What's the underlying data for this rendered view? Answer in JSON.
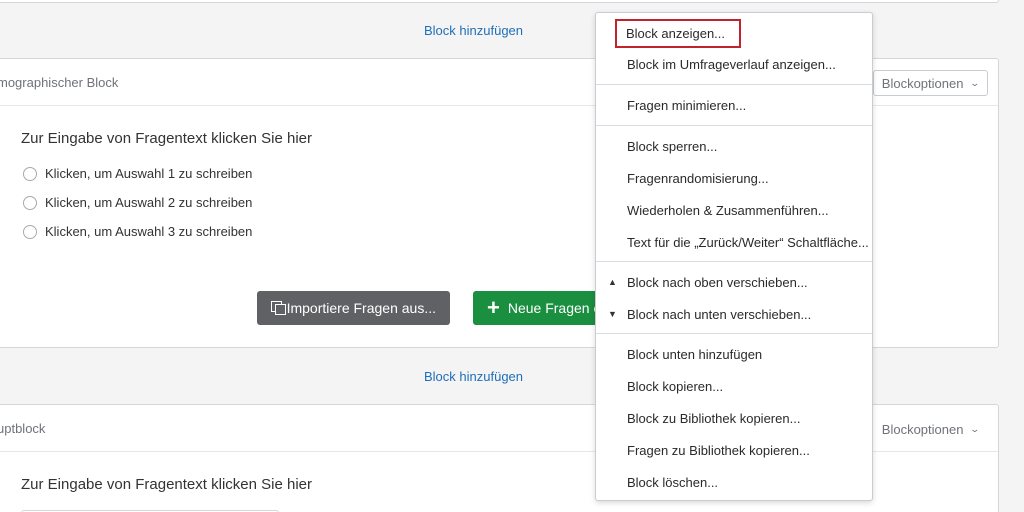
{
  "top": {
    "add_block_label": "Block hinzufügen"
  },
  "block1": {
    "name": "mographischer Block",
    "options_label": "Blockoptionen",
    "question_text": "Zur Eingabe von Fragentext klicken Sie hier",
    "choices": [
      "Klicken, um Auswahl 1 zu schreiben",
      "Klicken, um Auswahl 2 zu schreiben",
      "Klicken, um Auswahl 3 zu schreiben"
    ],
    "import_button": "Importiere Fragen aus...",
    "new_button": "Neue Fragen e"
  },
  "middle": {
    "add_block_label": "Block hinzufügen"
  },
  "block2": {
    "name": "uptblock",
    "options_label": "Blockoptionen",
    "question_text": "Zur Eingabe von Fragentext klicken Sie hier"
  },
  "menu": {
    "items": [
      "Block anzeigen...",
      "Block im Umfrageverlauf anzeigen...",
      "Fragen minimieren...",
      "Block sperren...",
      "Fragenrandomisierung...",
      "Wiederholen & Zusammenführen...",
      "Text für die „Zurück/Weiter“ Schaltfläche...",
      "Block nach oben verschieben...",
      "Block nach unten verschieben...",
      "Block unten hinzufügen",
      "Block kopieren...",
      "Block zu Bibliothek kopieren...",
      "Fragen zu Bibliothek kopieren...",
      "Block löschen..."
    ],
    "highlight_color": "#c0232b"
  },
  "colors": {
    "accent_link": "#1f6fb8",
    "new_button": "#1a8f3f",
    "import_button": "#5f6164"
  }
}
